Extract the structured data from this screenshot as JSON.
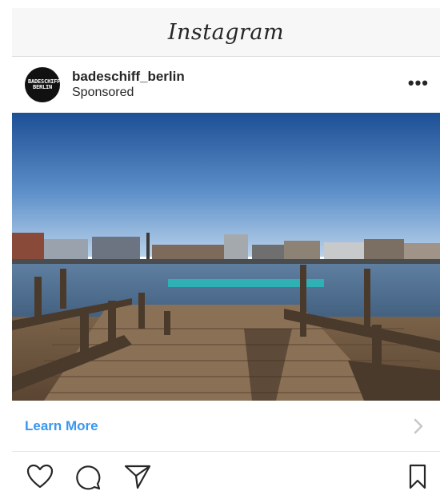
{
  "app": {
    "logo_text": "Instagram"
  },
  "post": {
    "username": "badeschiff_berlin",
    "subtitle": "Sponsored",
    "avatar_text": "BADESCHIFF BERLIN",
    "more_icon": "more-horizontal-icon"
  },
  "cta": {
    "label": "Learn More",
    "icon": "chevron-right-icon"
  },
  "actions": {
    "icons": [
      "heart-icon",
      "comment-icon",
      "share-icon",
      "bookmark-icon"
    ]
  },
  "colors": {
    "link": "#3897f0",
    "text": "#262626",
    "border": "#dbdbdb",
    "topbar": "#f7f7f7"
  }
}
